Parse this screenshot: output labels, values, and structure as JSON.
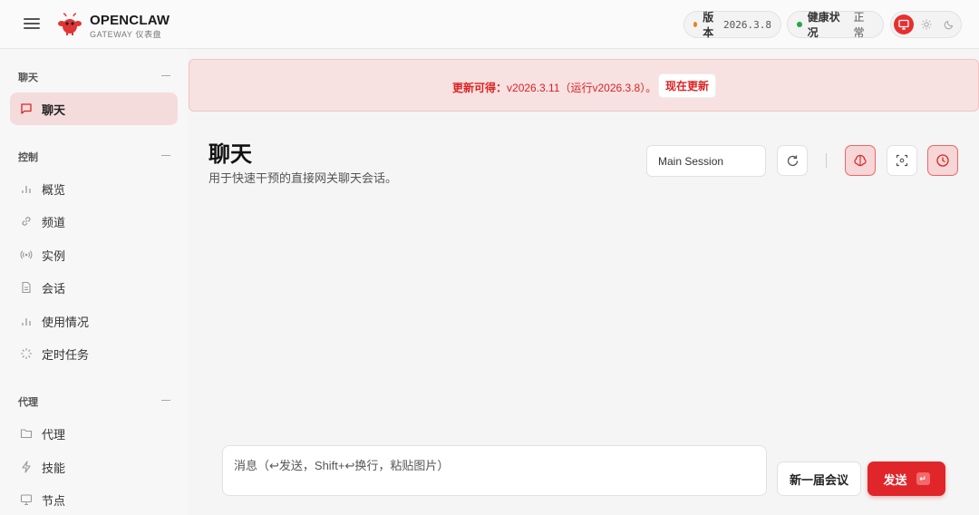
{
  "brand": {
    "title": "OPENCLAW",
    "subtitle": "GATEWAY 仪表盘"
  },
  "header": {
    "version_label": "版本",
    "version_value": "2026.3.8",
    "health_label": "健康状况",
    "health_value": "正常",
    "status_colors": {
      "version_dot": "#e8811a",
      "health_dot": "#22a845",
      "accent": "#e5302f"
    }
  },
  "sidebar": {
    "sections": [
      {
        "title": "聊天",
        "items": [
          {
            "label": "聊天",
            "icon": "message-square-icon",
            "active": true
          }
        ]
      },
      {
        "title": "控制",
        "items": [
          {
            "label": "概览",
            "icon": "bar-chart-icon"
          },
          {
            "label": "频道",
            "icon": "link-icon"
          },
          {
            "label": "实例",
            "icon": "radio-icon"
          },
          {
            "label": "会话",
            "icon": "file-text-icon"
          },
          {
            "label": "使用情况",
            "icon": "bar-chart-icon"
          },
          {
            "label": "定时任务",
            "icon": "loader-icon"
          }
        ]
      },
      {
        "title": "代理",
        "items": [
          {
            "label": "代理",
            "icon": "folder-icon"
          },
          {
            "label": "技能",
            "icon": "zap-icon"
          },
          {
            "label": "节点",
            "icon": "monitor-icon"
          }
        ]
      }
    ]
  },
  "banner": {
    "prefix": "更新可得：",
    "text": "v2026.3.11（运行v2026.3.8）。",
    "button": "现在更新"
  },
  "page": {
    "title": "聊天",
    "subtitle": "用于快速干预的直接网关聊天会话。",
    "session_select": "Main Session"
  },
  "composer": {
    "placeholder": "消息（↩发送，Shift+↩换行，粘贴图片）",
    "new_session_button": "新一届会议",
    "send_button": "发送",
    "send_kbd": "↵"
  }
}
